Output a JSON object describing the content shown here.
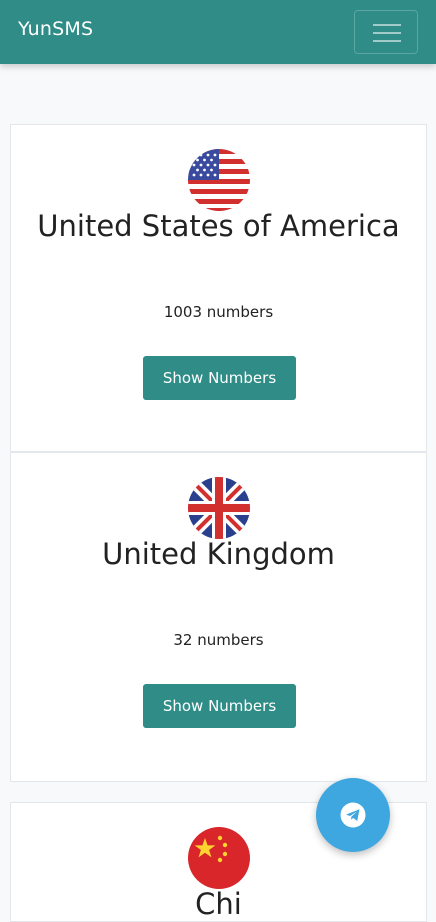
{
  "navbar": {
    "brand": "YunSMS",
    "menu_icon": "hamburger-menu-icon"
  },
  "countries": [
    {
      "name": "United States of America",
      "count": "1003 numbers",
      "button": "Show Numbers",
      "flag_icon": "us-flag-icon"
    },
    {
      "name": "United Kingdom",
      "count": "32 numbers",
      "button": "Show Numbers",
      "flag_icon": "uk-flag-icon"
    },
    {
      "name": "Chi",
      "count": "",
      "button": "",
      "flag_icon": "china-flag-icon"
    }
  ],
  "fab": {
    "icon": "telegram-icon"
  },
  "colors": {
    "primary": "#2f8c87",
    "fab": "#3fa7df",
    "background": "#f7f9fb"
  }
}
